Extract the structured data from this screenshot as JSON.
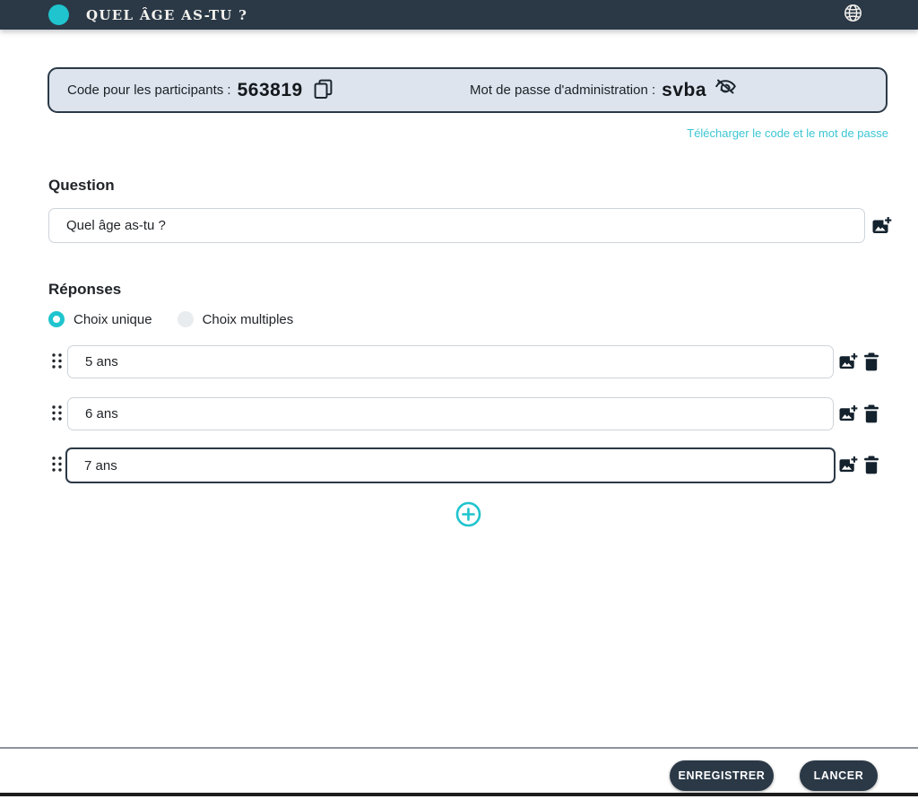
{
  "header": {
    "title": "QUEL ÂGE AS-TU ?"
  },
  "codebox": {
    "participants_label": "Code pour les participants :",
    "participants_code": "563819",
    "admin_label": "Mot de passe d'administration :",
    "admin_password": "svba"
  },
  "download_link": "Télécharger le code et le mot de passe",
  "question": {
    "heading": "Question",
    "value": "Quel âge as-tu ?"
  },
  "answers": {
    "heading": "Réponses",
    "choice_modes": [
      {
        "label": "Choix unique",
        "selected": true
      },
      {
        "label": "Choix multiples",
        "selected": false
      }
    ],
    "items": [
      {
        "value": "5 ans",
        "focused": false
      },
      {
        "value": "6 ans",
        "focused": false
      },
      {
        "value": "7 ans",
        "focused": true
      }
    ]
  },
  "footer": {
    "save_label": "ENREGISTRER",
    "launch_label": "LANCER"
  },
  "icons": {
    "language": "globe-icon",
    "copy_code": "copy-icon",
    "toggle_password": "eye-off-icon",
    "add_image": "add-image-icon",
    "delete_answer": "trash-icon",
    "reorder": "drag-handle-icon",
    "add_answer": "plus-circle-icon"
  },
  "colors": {
    "header_bg": "#2b3947",
    "accent_teal": "#1fc4ce",
    "codebox_bg": "#dde4ee",
    "link_teal": "#3cc6d3",
    "input_border": "#ced4da",
    "focused_border": "#2b3947",
    "text": "#212529"
  }
}
